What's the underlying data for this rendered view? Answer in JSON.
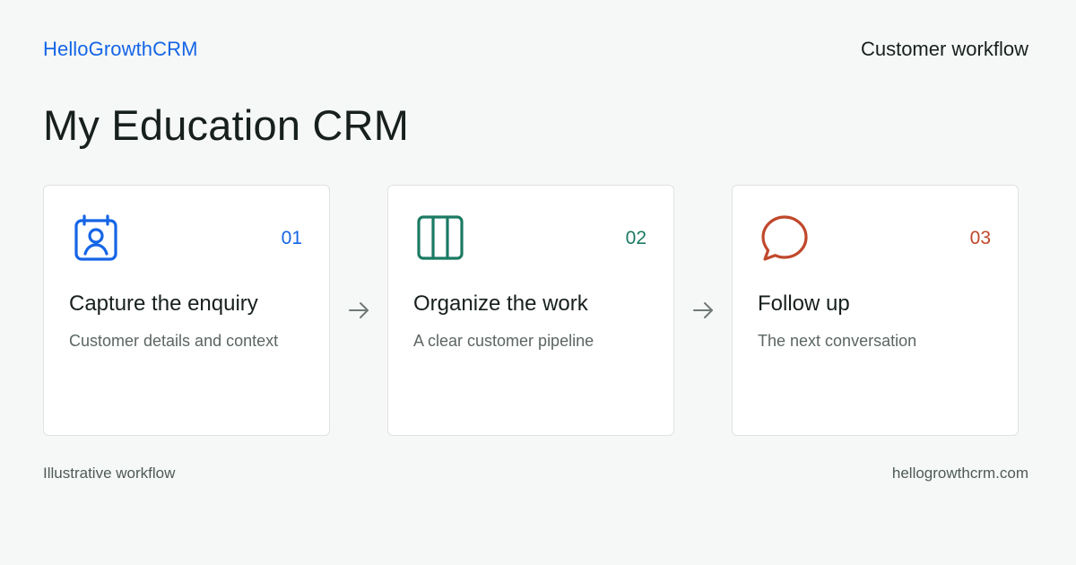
{
  "header": {
    "brand": "HelloGrowthCRM",
    "tagline": "Customer workflow"
  },
  "title": "My Education CRM",
  "steps": [
    {
      "number": "01",
      "heading": "Capture the enquiry",
      "description": "Customer details and context",
      "icon": "contact-card-icon",
      "color": "#1565e6"
    },
    {
      "number": "02",
      "heading": "Organize the work",
      "description": "A clear customer pipeline",
      "icon": "columns-board-icon",
      "color": "#1b7a63"
    },
    {
      "number": "03",
      "heading": "Follow up",
      "description": "The next conversation",
      "icon": "chat-bubble-icon",
      "color": "#c0482c"
    }
  ],
  "footer": {
    "left": "Illustrative workflow",
    "right": "hellogrowthcrm.com"
  }
}
